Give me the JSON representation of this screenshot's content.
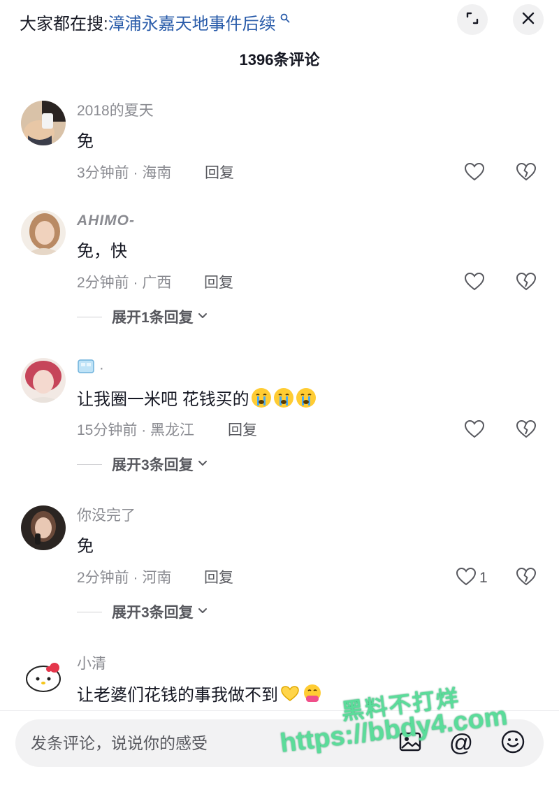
{
  "header": {
    "search_prefix": "大家都在搜:",
    "search_term": "漳浦永嘉天地事件后续",
    "comment_count_title": "1396条评论"
  },
  "comments": [
    {
      "username": "2018的夏天",
      "text": "免",
      "time_location": "3分钟前 · 海南",
      "reply_label": "回复",
      "likes": "",
      "expand_label": ""
    },
    {
      "username": "AHIMO-",
      "text": "免，快",
      "time_location": "2分钟前 · 广西",
      "reply_label": "回复",
      "likes": "",
      "expand_label": "展开1条回复"
    },
    {
      "username": "·",
      "text": "让我圈一米吧 花钱买的",
      "time_location": "15分钟前 · 黑龙江",
      "reply_label": "回复",
      "likes": "",
      "expand_label": "展开3条回复"
    },
    {
      "username": "你没完了",
      "text": "免",
      "time_location": "2分钟前 · 河南",
      "reply_label": "回复",
      "likes": "1",
      "expand_label": "展开3条回复"
    },
    {
      "username": "小清",
      "text": "让老婆们花钱的事我做不到",
      "time_location": "",
      "reply_label": "",
      "likes": "",
      "expand_label": ""
    }
  ],
  "input": {
    "placeholder": "发条评论，说说你的感受",
    "at_symbol": "@"
  },
  "watermark": {
    "line1": "黑料不打烊",
    "line2": "https://bbdy4.com"
  },
  "icons": {
    "expand": "expand-icon",
    "close": "close-icon",
    "like": "heart-outline-icon",
    "dislike": "broken-heart-icon",
    "chevron": "chevron-down-icon",
    "image": "image-icon",
    "emoji": "smiley-icon"
  },
  "colors": {
    "link": "#2a5caa",
    "muted": "#8a8b91",
    "text": "#161823",
    "watermark": "#5bdc9a"
  }
}
